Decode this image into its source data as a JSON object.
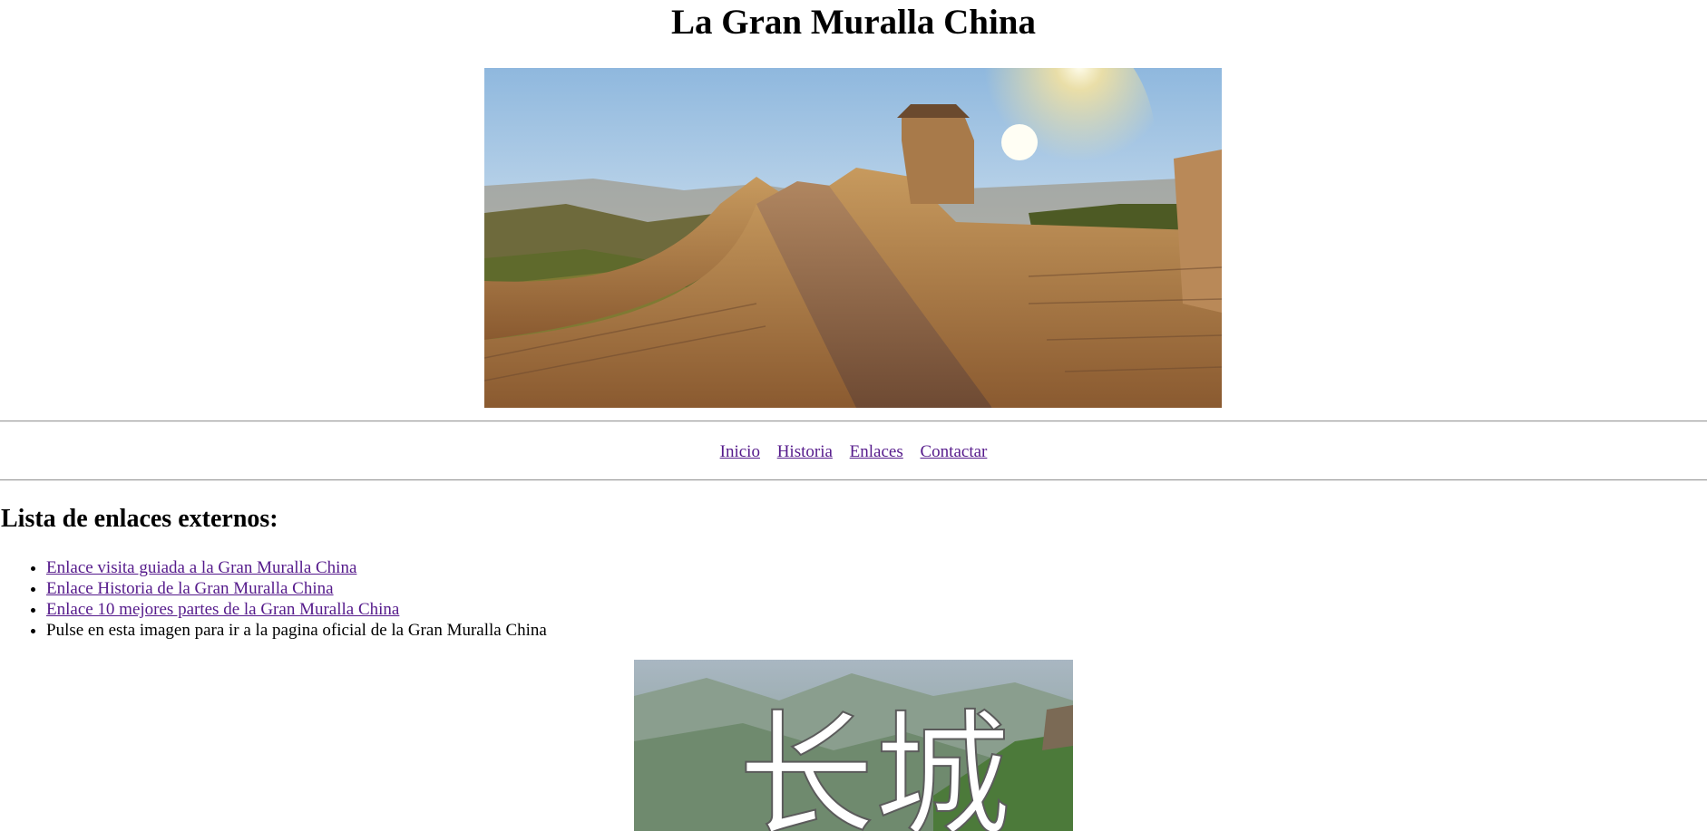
{
  "page": {
    "title": "La Gran Muralla China"
  },
  "nav": {
    "items": [
      {
        "label": "Inicio"
      },
      {
        "label": "Historia"
      },
      {
        "label": "Enlaces"
      },
      {
        "label": "Contactar"
      }
    ]
  },
  "links_section": {
    "heading": "Lista de enlaces externos:",
    "items": [
      {
        "label": "Enlace visita guiada a la Gran Muralla China"
      },
      {
        "label": "Enlace Historia de la Gran Muralla China"
      },
      {
        "label": "Enlace 10 mejores partes de la Gran Muralla China"
      },
      {
        "label": "Pulse en esta imagen para ir a la pagina oficial de la Gran Muralla China"
      }
    ]
  },
  "official_image": {
    "caption_glyphs": "长城"
  },
  "colors": {
    "visited_link": "#551a8b",
    "rule": "#9a9a9a"
  }
}
